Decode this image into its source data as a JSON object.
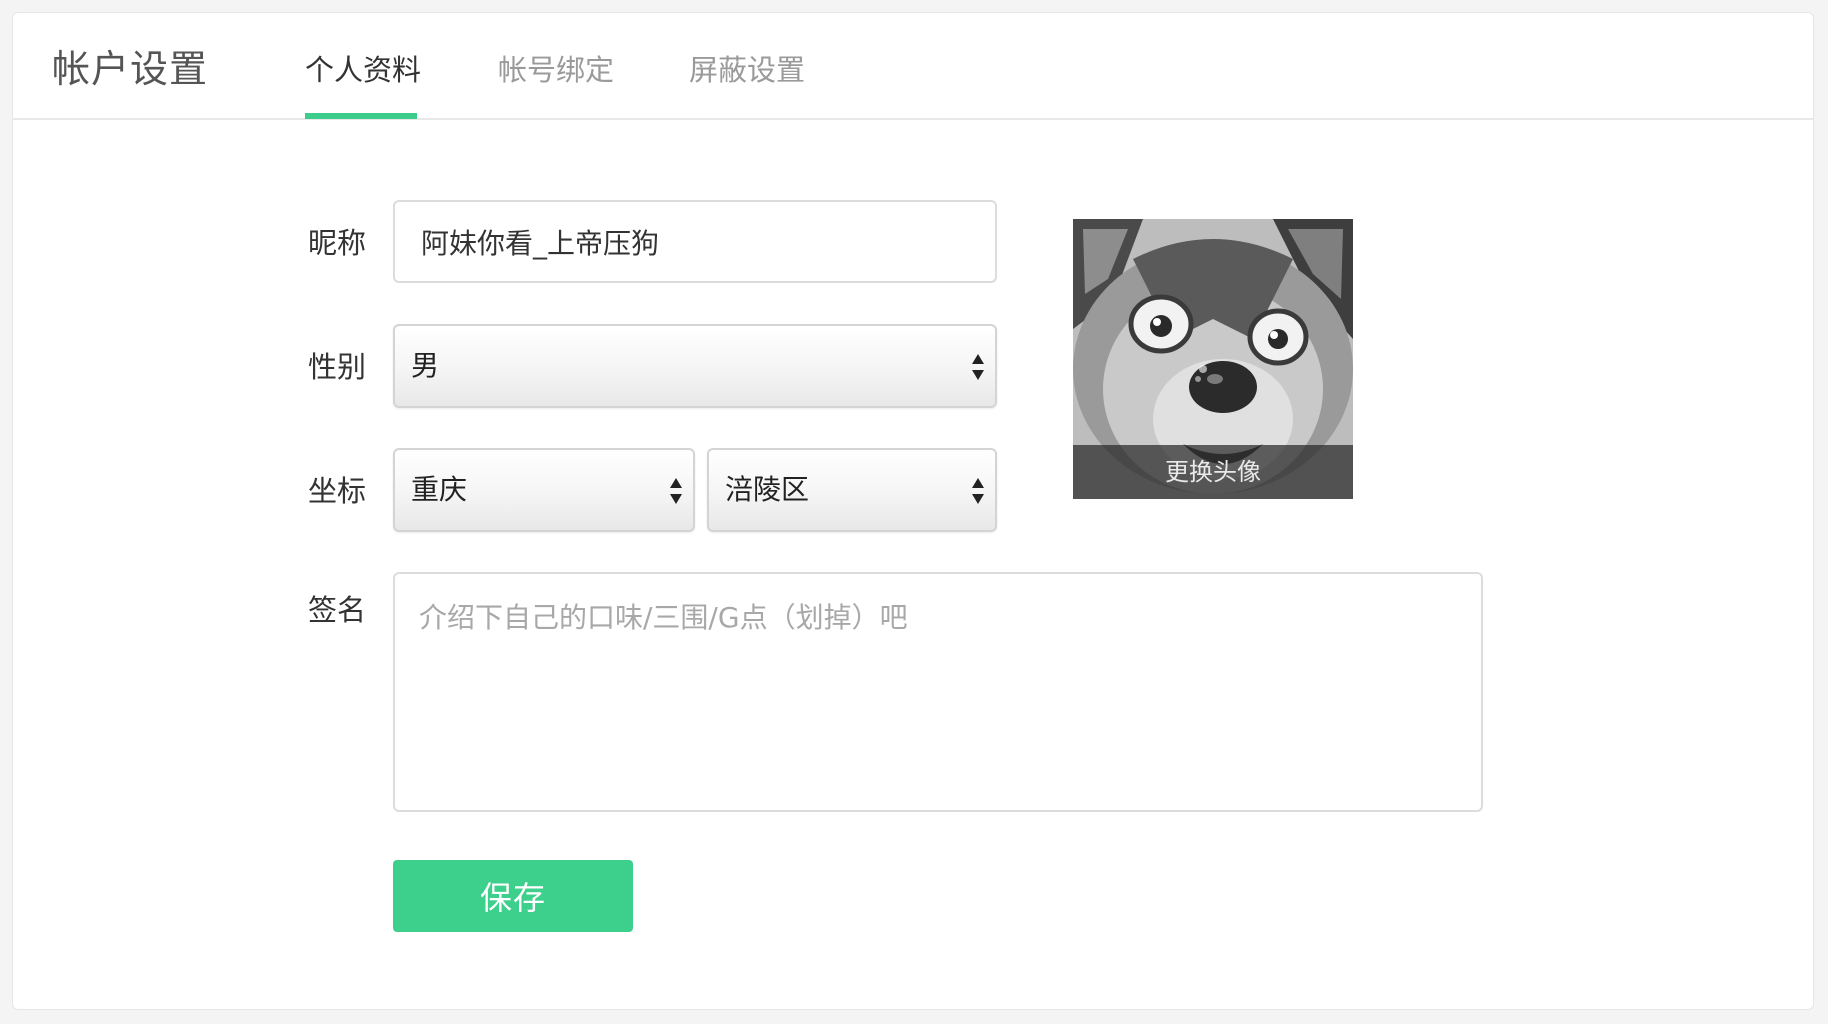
{
  "header": {
    "title": "帐户设置",
    "tabs": [
      {
        "label": "个人资料",
        "active": true
      },
      {
        "label": "帐号绑定",
        "active": false
      },
      {
        "label": "屏蔽设置",
        "active": false
      }
    ]
  },
  "form": {
    "nickname": {
      "label": "昵称",
      "value": "阿妹你看_上帝压狗"
    },
    "gender": {
      "label": "性别",
      "selected": "男"
    },
    "location": {
      "label": "坐标",
      "province": "重庆",
      "city": "涪陵区"
    },
    "signature": {
      "label": "签名",
      "value": "",
      "placeholder": "介绍下自己的口味/三围/G点（划掉）吧"
    },
    "save_label": "保存"
  },
  "avatar": {
    "change_label": "更换头像",
    "icon": "husky-dog-avatar"
  },
  "colors": {
    "accent": "#3dcc8b",
    "save_button": "#3dd08d"
  }
}
